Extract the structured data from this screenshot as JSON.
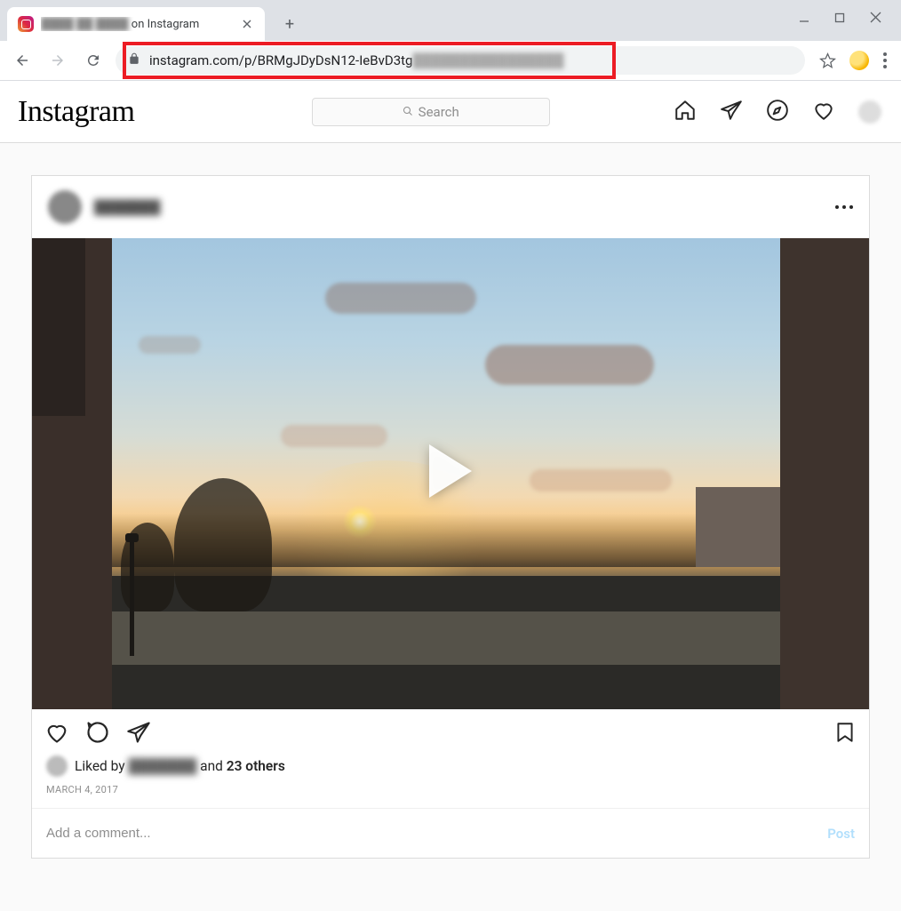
{
  "browser": {
    "tab": {
      "title_blur": "████ ██ ████",
      "title_suffix": " on Instagram"
    },
    "url_visible": "instagram.com/p/BRMgJDyDsN12-IeBvD3tg",
    "url_blur": "████████████████"
  },
  "ig_header": {
    "logo": "Instagram",
    "search_placeholder": "Search"
  },
  "post": {
    "username_blur": "███████",
    "likes": {
      "prefix": "Liked by ",
      "name_blur": "███████",
      "middle": " and ",
      "count": "23 others"
    },
    "date": "MARCH 4, 2017",
    "comment_placeholder": "Add a comment...",
    "post_button": "Post"
  }
}
